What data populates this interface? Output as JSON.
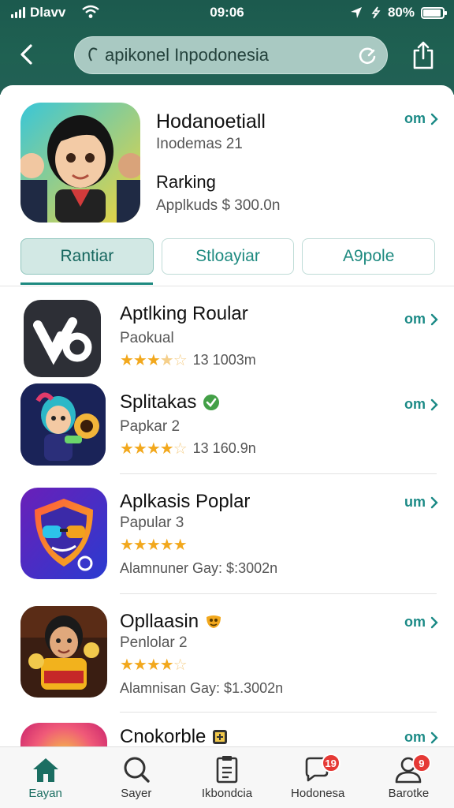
{
  "status_bar": {
    "carrier": "Dlavv",
    "time": "09:06",
    "battery": "80%"
  },
  "search": {
    "placeholder": "apikonel Inpodonesia"
  },
  "featured": {
    "title": "Hodanoetiall",
    "subtitle": "Inodemas 21",
    "ranking_label": "Rarking",
    "price": "Applkuds $ 300.0n",
    "open_label": "om"
  },
  "segments": [
    {
      "label": "Rantiar",
      "active": true
    },
    {
      "label": "Stloayiar",
      "active": false
    },
    {
      "label": "A9pole",
      "active": false
    }
  ],
  "apps": [
    {
      "name": "Aptlking Roular",
      "category": "Paokual",
      "rating": 3.5,
      "stat": "13 1003m",
      "open": "om",
      "icon": "vo-logo-icon"
    },
    {
      "name": "Splitakas",
      "category": "Papkar 2",
      "rating": 4.5,
      "stat": "13 160.9n",
      "open": "om",
      "icon": "hero-character-icon",
      "verified": true
    },
    {
      "name": "Aplkasis Poplar",
      "category": "Papular 3",
      "rating": 5,
      "stat": "Alamnuner Gay: $:3002n",
      "open": "um",
      "icon": "shield-glasses-icon"
    },
    {
      "name": "Opllaasin",
      "category": "Penlolar 2",
      "rating": 4.5,
      "stat": "Alamnisan Gay: $1.3002n",
      "open": "om",
      "icon": "boy-character-icon"
    },
    {
      "name": "Cnokorble",
      "category": "",
      "rating": 0,
      "stat": "",
      "open": "om",
      "icon": "gradient-app-icon"
    }
  ],
  "tabs": [
    {
      "label": "Eayan",
      "icon": "home-icon",
      "active": true
    },
    {
      "label": "Sayer",
      "icon": "search-icon",
      "active": false
    },
    {
      "label": "Ikbondcia",
      "icon": "clipboard-icon",
      "active": false
    },
    {
      "label": "Hodonesa",
      "icon": "chat-icon",
      "active": false,
      "badge": "19"
    },
    {
      "label": "Barotke",
      "icon": "profile-icon",
      "active": false,
      "badge": "9"
    }
  ],
  "colors": {
    "header": "#1f6152",
    "accent": "#1e8a80",
    "star": "#f2a81d",
    "badge": "#e53935"
  }
}
